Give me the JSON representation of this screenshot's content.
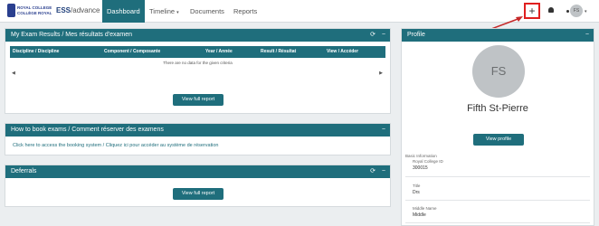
{
  "nav": {
    "logo_line1": "ROYAL COLLEGE",
    "logo_line2": "COLLÈGE ROYAL",
    "brand_a": "ESS",
    "brand_b": "/advance",
    "items": [
      "Dashboard",
      "Timeline",
      "Documents",
      "Reports"
    ],
    "timeline_caret": "▾",
    "add_symbol": "+",
    "avatar_initials": "FS",
    "avatar_caret": "▾"
  },
  "exam_results": {
    "title": "My Exam Results / Mes résultats d'examen",
    "columns": [
      "Discipline / Discipline",
      "Component / Composante",
      "Year / Année",
      "Result / Résultat",
      "View / Accéder"
    ],
    "empty_message": "There are no data for the given criteria",
    "button": "View full report"
  },
  "how_to_book": {
    "title": "How to book exams / Comment réserver des examens",
    "link": "Click here to access the booking system / Cliquez ici pour accéder au système de réservation"
  },
  "deferrals": {
    "title": "Deferrals",
    "button": "View full report"
  },
  "profile": {
    "title": "Profile",
    "initials": "FS",
    "name": "Fifth St-Pierre",
    "button": "View profile",
    "basic_info_label": "Basic Information",
    "fields": [
      {
        "label": "Royal College ID",
        "value": "300015"
      },
      {
        "label": "Title",
        "value": "Drs"
      },
      {
        "label": "Middle Name",
        "value": "Middle"
      }
    ]
  },
  "icons": {
    "refresh": "⟳",
    "collapse": "−",
    "scroll_left": "◀",
    "scroll_right": "▶"
  },
  "colors": {
    "header_teal": "#1f6e7c",
    "highlight_red": "#e01f1f"
  }
}
